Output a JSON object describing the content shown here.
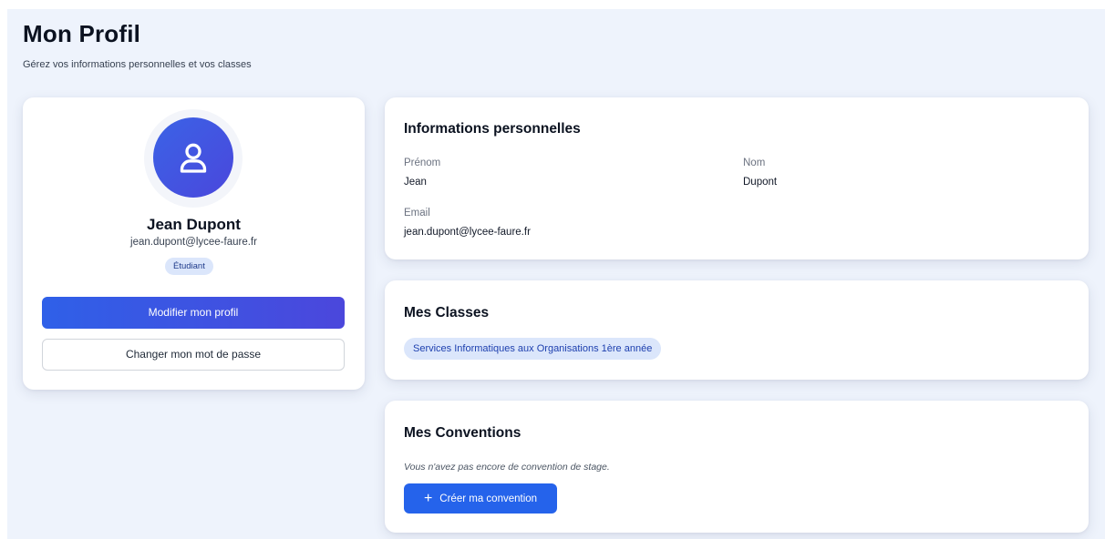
{
  "header": {
    "title": "Mon Profil",
    "subtitle": "Gérez vos informations personnelles et vos classes"
  },
  "profile": {
    "avatar_icon": "user-icon",
    "name": "Jean Dupont",
    "email": "jean.dupont@lycee-faure.fr",
    "role": "Étudiant",
    "edit_label": "Modifier mon profil",
    "password_label": "Changer mon mot de passe"
  },
  "personal_info": {
    "title": "Informations personnelles",
    "first_name_label": "Prénom",
    "first_name": "Jean",
    "last_name_label": "Nom",
    "last_name": "Dupont",
    "email_label": "Email",
    "email": "jean.dupont@lycee-faure.fr"
  },
  "classes": {
    "title": "Mes Classes",
    "items": [
      "Services Informatiques aux Organisations 1ère année"
    ]
  },
  "conventions": {
    "title": "Mes Conventions",
    "empty_text": "Vous n'avez pas encore de convention de stage.",
    "create_icon": "plus-icon",
    "create_label": "Créer ma convention"
  },
  "colors": {
    "accent": "#2563eb",
    "accent_end": "#4b47dc",
    "background": "#eef3fc",
    "badge_bg": "#dbe6fb"
  }
}
